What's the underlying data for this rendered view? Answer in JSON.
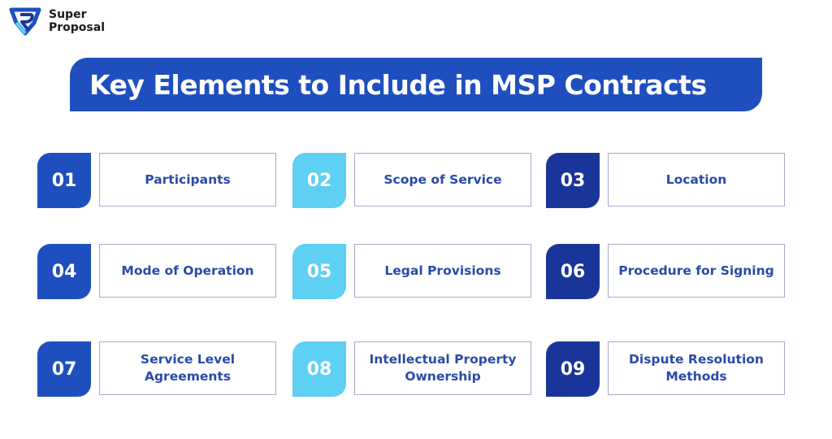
{
  "brand": {
    "line1": "Super",
    "line2": "Proposal",
    "icon": "super-proposal-logo-icon"
  },
  "title": "Key Elements to Include in MSP Contracts",
  "colors": {
    "primary": "#1f4fbf",
    "light": "#5dd0f4",
    "dark": "#1a359a",
    "label_text": "#2a4aa8",
    "border": "#a6a9cf"
  },
  "items": [
    {
      "number": "01",
      "label": "Participants"
    },
    {
      "number": "02",
      "label": "Scope of Service"
    },
    {
      "number": "03",
      "label": "Location"
    },
    {
      "number": "04",
      "label": "Mode of Operation"
    },
    {
      "number": "05",
      "label": "Legal Provisions"
    },
    {
      "number": "06",
      "label": "Procedure for Signing"
    },
    {
      "number": "07",
      "label": "Service Level Agreements"
    },
    {
      "number": "08",
      "label": "Intellectual Property Ownership"
    },
    {
      "number": "09",
      "label": "Dispute Resolution Methods"
    }
  ]
}
